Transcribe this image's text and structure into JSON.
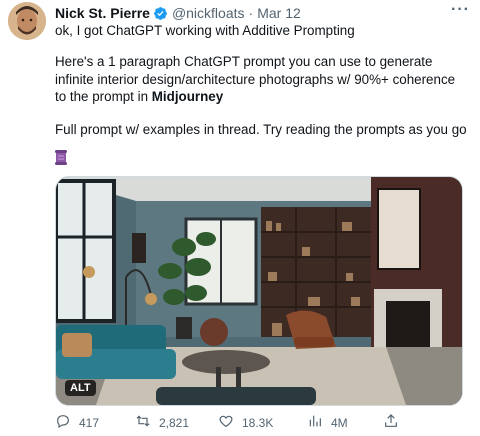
{
  "tweet": {
    "author_name": "Nick St. Pierre",
    "handle": "@nickfloats",
    "separator": "·",
    "date": "Mar 12",
    "more": "···",
    "line1": "ok, I got ChatGPT working with Additive Prompting",
    "line2_before": "Here's a 1 paragraph ChatGPT prompt you can use to generate infinite interior design/architecture photographs w/ 90%+ coherence to the prompt in ",
    "line2_bold": "Midjourney",
    "line3": "Full prompt w/ examples in thread. Try reading the prompts as you go",
    "media_alt_badge": "ALT",
    "icons": {
      "verified": "verified-badge-icon",
      "more": "more-icon",
      "emoji": "scroll-emoji-icon",
      "reply": "reply-icon",
      "retweet": "retweet-icon",
      "like": "like-icon",
      "views": "views-icon",
      "share": "share-icon"
    },
    "colors": {
      "verified": "#1d9bf0",
      "muted": "#536471",
      "text": "#0f1419"
    }
  },
  "actions": {
    "replies": "417",
    "retweets": "2,821",
    "likes": "18.3K",
    "views": "4M"
  }
}
